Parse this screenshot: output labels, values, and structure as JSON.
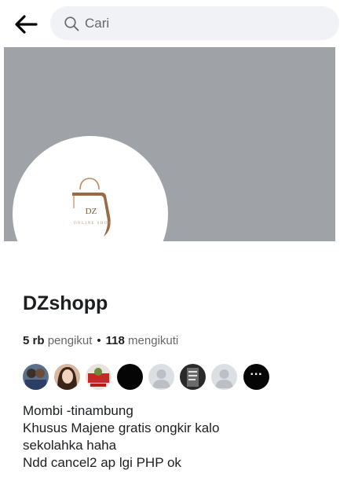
{
  "header": {
    "back_icon": "arrow-left-icon",
    "search": {
      "placeholder": "Cari",
      "value": "",
      "icon": "search-icon"
    }
  },
  "profile": {
    "cover_color": "#9fa2a6",
    "logo": {
      "initials": "DZ",
      "tagline": "ONLINE SHOP"
    },
    "name": "DZshopp",
    "followers_count": "5 rb",
    "followers_label": "pengikut",
    "separator": "•",
    "following_count": "118",
    "following_label": "mengikuti",
    "more_icon": "more-dots-icon",
    "more_label": "···"
  },
  "follower_avatars": [
    "avatar-1",
    "avatar-2",
    "avatar-3",
    "avatar-4",
    "avatar-5",
    "avatar-6",
    "avatar-7"
  ],
  "bio": {
    "lines": [
      "Mombi -tinambung",
      "Khusus Majene gratis ongkir kalo",
      "sekolahka haha",
      "Ndd cancel2 ap lgi PHP ok"
    ]
  }
}
